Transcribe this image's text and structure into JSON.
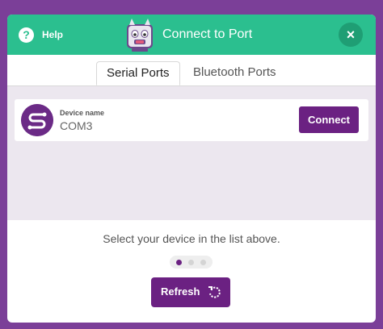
{
  "header": {
    "help_label": "Help",
    "help_icon": "?",
    "title": "Connect to Port",
    "close_icon": "×",
    "accent_color": "#2bbf8f"
  },
  "tabs": [
    {
      "label": "Serial Ports",
      "active": true
    },
    {
      "label": "Bluetooth Ports",
      "active": false
    }
  ],
  "devices": [
    {
      "label_caption": "Device name",
      "name": "COM3",
      "connect_label": "Connect"
    }
  ],
  "footer": {
    "hint": "Select your device in the list above.",
    "pager_active_index": 0,
    "pager_count": 3,
    "refresh_label": "Refresh"
  },
  "brand_color": "#6b2182"
}
